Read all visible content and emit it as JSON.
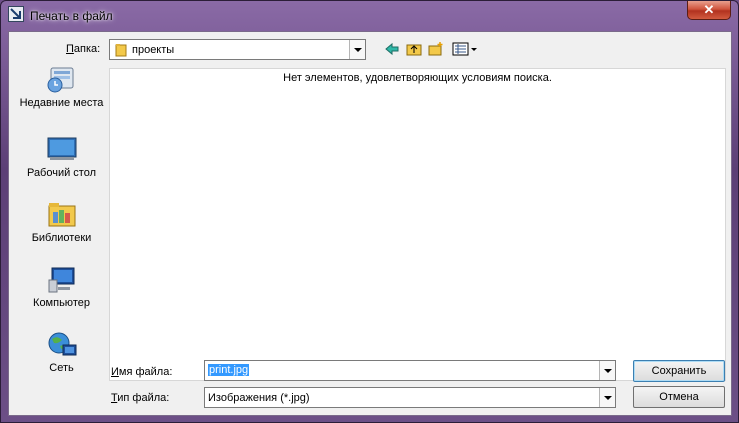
{
  "window": {
    "title": "Печать в файл",
    "close_glyph": "✕"
  },
  "lookin": {
    "label_u": "П",
    "label_rest": "апка:",
    "value": "проекты"
  },
  "places": [
    {
      "id": "recent",
      "icon": "recent-places-icon",
      "label": "Недавние места"
    },
    {
      "id": "desktop",
      "icon": "desktop-icon",
      "label": "Рабочий стол"
    },
    {
      "id": "libraries",
      "icon": "libraries-icon",
      "label": "Библиотеки"
    },
    {
      "id": "computer",
      "icon": "computer-icon",
      "label": "Компьютер"
    },
    {
      "id": "network",
      "icon": "network-icon",
      "label": "Сеть"
    }
  ],
  "filelist": {
    "empty_message": "Нет элементов, удовлетворяющих условиям поиска."
  },
  "filename": {
    "label_u": "И",
    "label_rest": "мя файла:",
    "value": "print.jpg"
  },
  "filetype": {
    "label_u": "Т",
    "label_rest": "ип файла:",
    "value": "Изображения (*.jpg)"
  },
  "buttons": {
    "save": "Сохранить",
    "cancel": "Отмена"
  },
  "colors": {
    "accent": "#3399ff",
    "titlebar": "#6c4f86",
    "close": "#c9462f"
  }
}
